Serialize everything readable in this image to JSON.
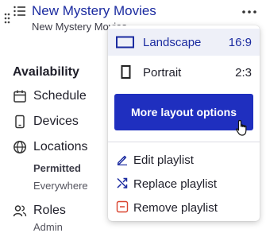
{
  "playlist": {
    "title": "New Mystery Movies",
    "subtitle": "New Mystery Movies"
  },
  "availability": {
    "title": "Availability",
    "items": [
      {
        "label": "Schedule",
        "icon": "calendar-icon"
      },
      {
        "label": "Devices",
        "icon": "device-icon"
      },
      {
        "label": "Locations",
        "icon": "globe-icon"
      }
    ],
    "locations_status": "Permitted",
    "locations_value": "Everywhere",
    "roles_label": "Roles",
    "roles_value": "Admin"
  },
  "menu": {
    "landscape": {
      "label": "Landscape",
      "ratio": "16:9",
      "selected": true
    },
    "portrait": {
      "label": "Portrait",
      "ratio": "2:3"
    },
    "layout_button": "More layout options",
    "edit": "Edit playlist",
    "replace": "Replace playlist",
    "remove": "Remove playlist"
  },
  "colors": {
    "accent": "#1f2fbf",
    "title_blue": "#1b2ba0",
    "danger": "#d9432f",
    "selected_bg": "#eef0f8"
  }
}
